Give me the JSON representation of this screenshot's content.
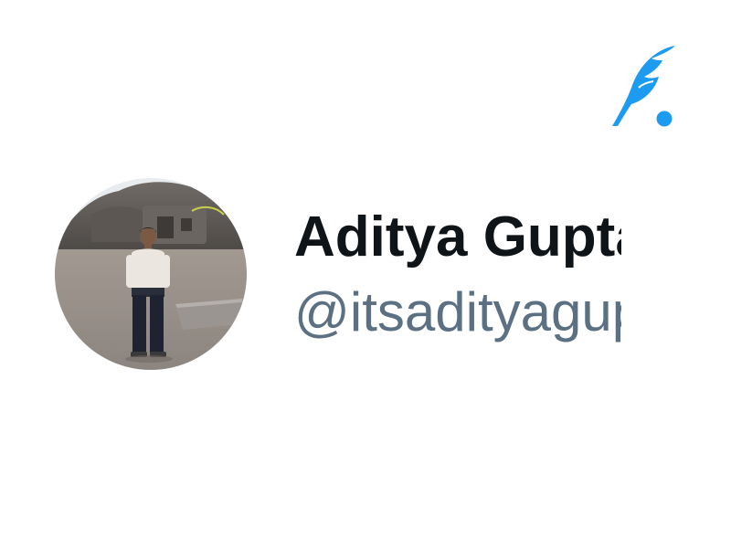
{
  "profile": {
    "display_name": "Aditya Gupta",
    "handle": "@itsadityagupta",
    "avatar": "profile-photo"
  },
  "brand": {
    "logo": "quill-icon",
    "accent_color": "#1d9bf0"
  },
  "colors": {
    "name_color": "#0f1419",
    "handle_color": "#5b7083",
    "background": "#ffffff"
  }
}
